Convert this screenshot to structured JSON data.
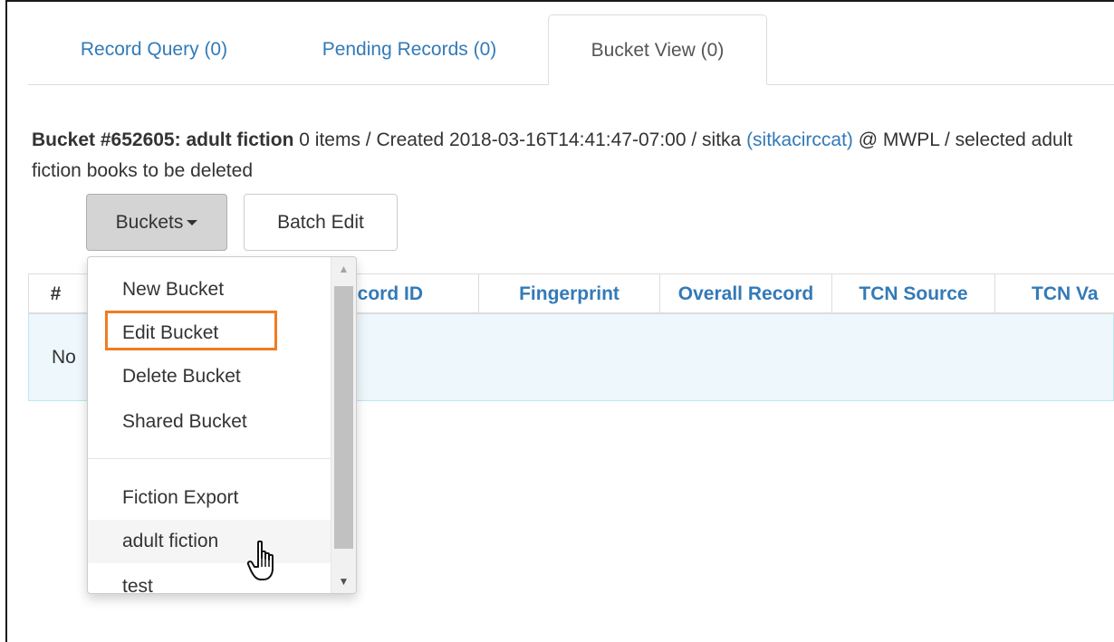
{
  "tabs": [
    {
      "label": "Record Query (0)"
    },
    {
      "label": "Pending Records (0)"
    },
    {
      "label": "Bucket View (0)"
    }
  ],
  "bucket": {
    "title": "Bucket #652605: adult fiction",
    "details": " 0 items / Created 2018-03-16T14:41:47-07:00 / sitka ",
    "owner_link": "(sitkacirccat)",
    "location": " @ MWPL / selected adult fiction books to be deleted"
  },
  "toolbar": {
    "buckets_label": "Buckets",
    "batch_edit_label": "Batch Edit"
  },
  "table": {
    "headers": {
      "hash": "#",
      "record_id": "ecord ID",
      "fingerprint": "Fingerprint",
      "overall_record": "Overall Record",
      "tcn_source": "TCN Source",
      "tcn_value": "TCN Va"
    },
    "empty_text": "No"
  },
  "menu": {
    "actions": [
      "New Bucket",
      "Edit Bucket",
      "Delete Bucket",
      "Shared Bucket"
    ],
    "buckets": [
      "Fiction Export",
      "adult fiction",
      "test"
    ]
  },
  "colors": {
    "link": "#337ab7",
    "highlight": "#f07c22",
    "empty_row_bg": "#eef7fb"
  },
  "icons": {
    "cursor": "hand-pointer-icon",
    "caret": "caret-down-icon"
  }
}
